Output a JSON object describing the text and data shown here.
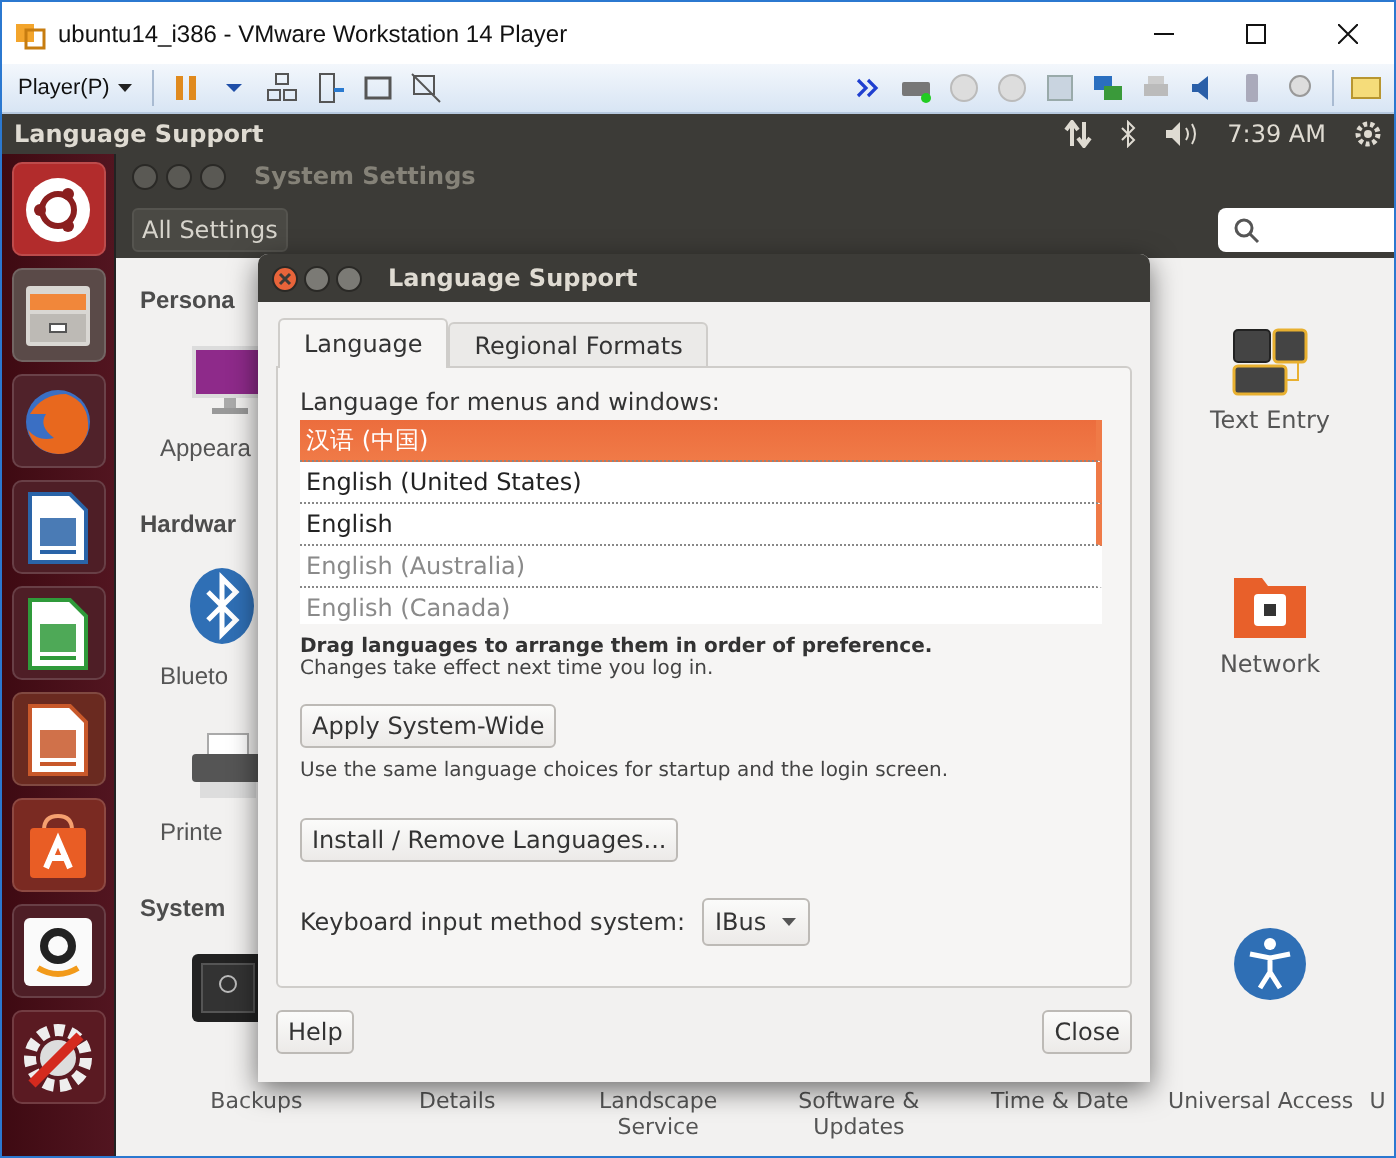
{
  "vm_window": {
    "title": "ubuntu14_i386 - VMware Workstation 14 Player",
    "menu": "Player(P)"
  },
  "top_panel": {
    "title": "Language Support",
    "clock": "7:39 AM"
  },
  "launcher": [
    {
      "kind": "ubuntu"
    },
    {
      "kind": "files"
    },
    {
      "kind": "firefox"
    },
    {
      "kind": "writer"
    },
    {
      "kind": "calc"
    },
    {
      "kind": "impress"
    },
    {
      "kind": "software"
    },
    {
      "kind": "amazon"
    },
    {
      "kind": "settings"
    }
  ],
  "system_settings": {
    "title": "System Settings",
    "all_settings": "All Settings",
    "left": [
      {
        "kind": "heading",
        "label": "Persona"
      },
      {
        "kind": "monitor",
        "label": "Appeara"
      },
      {
        "kind": "heading",
        "label": "Hardwar"
      },
      {
        "kind": "bluetooth",
        "label": "Blueto"
      },
      {
        "kind": "printer",
        "label": "Printe"
      },
      {
        "kind": "heading",
        "label": "System"
      },
      {
        "kind": "safe"
      }
    ],
    "right": [
      {
        "kind": "keyboard",
        "label": "Text Entry"
      },
      {
        "kind": "folder",
        "label": "Network"
      },
      {
        "kind": "access"
      }
    ],
    "bottom_labels": [
      "Backups",
      "Details",
      "Landscape Service",
      "Software & Updates",
      "Time & Date",
      "Universal Access",
      "U"
    ]
  },
  "dialog": {
    "title": "Language Support",
    "tabs": [
      {
        "label": "Language",
        "selected": true
      },
      {
        "label": "Regional Formats",
        "selected": false
      }
    ],
    "list_label": "Language for menus and windows:",
    "languages": [
      {
        "label": "汉语 (中国)",
        "selected": true,
        "installed": true
      },
      {
        "label": "English (United States)",
        "selected": false,
        "installed": true
      },
      {
        "label": "English",
        "selected": false,
        "installed": true
      },
      {
        "label": "English (Australia)",
        "selected": false,
        "installed": false
      },
      {
        "label": "English (Canada)",
        "selected": false,
        "installed": false
      }
    ],
    "drag_hint": "Drag languages to arrange them in order of preference.",
    "changes_note": "Changes take effect next time you log in.",
    "apply_button": "Apply System-Wide",
    "apply_note": "Use the same language choices for startup and the login screen.",
    "install_button": "Install / Remove Languages...",
    "input_label": "Keyboard input method system:",
    "input_value": "IBus",
    "help_button": "Help",
    "close_button": "Close"
  }
}
